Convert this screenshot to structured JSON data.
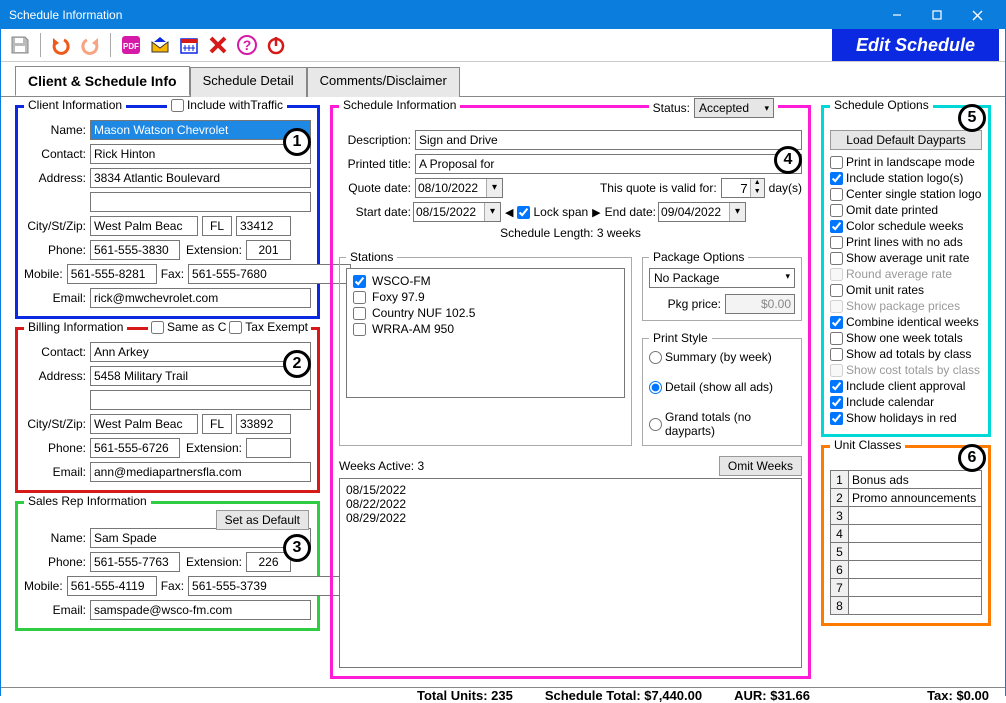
{
  "window": {
    "title": "Schedule Information"
  },
  "edit_btn": "Edit Schedule",
  "tabs": [
    "Client & Schedule Info",
    "Schedule Detail",
    "Comments/Disclaimer"
  ],
  "client": {
    "title": "Client Information",
    "include_traffic": "Include withTraffic",
    "name_lbl": "Name:",
    "name": "Mason Watson Chevrolet",
    "contact_lbl": "Contact:",
    "contact": "Rick Hinton",
    "address_lbl": "Address:",
    "address": "3834 Atlantic Boulevard",
    "csz_lbl": "City/St/Zip:",
    "city": "West Palm Beac",
    "state": "FL",
    "zip": "33412",
    "phone_lbl": "Phone:",
    "phone": "561-555-3830",
    "ext_lbl": "Extension:",
    "ext": "201",
    "mobile_lbl": "Mobile:",
    "mobile": "561-555-8281",
    "fax_lbl": "Fax:",
    "fax": "561-555-7680",
    "email_lbl": "Email:",
    "email": "rick@mwchevrolet.com"
  },
  "billing": {
    "title": "Billing Information",
    "same_lbl": "Same as Client",
    "taxexempt_lbl": "Tax Exempt",
    "contact_lbl": "Contact:",
    "contact": "Ann Arkey",
    "address_lbl": "Address:",
    "address": "5458 Military Trail",
    "csz_lbl": "City/St/Zip:",
    "city": "West Palm Beac",
    "state": "FL",
    "zip": "33892",
    "phone_lbl": "Phone:",
    "phone": "561-555-6726",
    "ext_lbl": "Extension:",
    "ext": "",
    "email_lbl": "Email:",
    "email": "ann@mediapartnersfla.com"
  },
  "salesrep": {
    "title": "Sales Rep Information",
    "setdefault": "Set as Default",
    "name_lbl": "Name:",
    "name": "Sam Spade",
    "phone_lbl": "Phone:",
    "phone": "561-555-7763",
    "ext_lbl": "Extension:",
    "ext": "226",
    "mobile_lbl": "Mobile:",
    "mobile": "561-555-4119",
    "fax_lbl": "Fax:",
    "fax": "561-555-3739",
    "email_lbl": "Email:",
    "email": "samspade@wsco-fm.com"
  },
  "sched": {
    "title": "Schedule Information",
    "status_lbl": "Status:",
    "status": "Accepted",
    "desc_lbl": "Description:",
    "desc": "Sign and Drive",
    "ptitle_lbl": "Printed title:",
    "ptitle": "A Proposal for",
    "qdate_lbl": "Quote date:",
    "qdate": "08/10/2022",
    "valid_lbl": "This quote is valid for:",
    "valid_days": "7",
    "days_lbl": "day(s)",
    "sdate_lbl": "Start date:",
    "sdate": "08/15/2022",
    "lockspan": "Lock span",
    "endtri": "▶",
    "edate_lbl": "End date:",
    "edate": "09/04/2022",
    "schedlen": "Schedule Length: 3 weeks",
    "stations_lbl": "Stations",
    "stations": [
      "WSCO-FM",
      "Foxy 97.9",
      "Country NUF 102.5",
      "WRRA-AM 950"
    ],
    "pkg_lbl": "Package Options",
    "pkg": "No Package",
    "pkgprice_lbl": "Pkg price:",
    "pkgprice": "$0.00",
    "pstyle_lbl": "Print Style",
    "pstyle": [
      "Summary (by week)",
      "Detail (show all ads)",
      "Grand totals (no dayparts)"
    ],
    "weeks_lbl": "Weeks Active: 3",
    "omit": "Omit Weeks",
    "weeks": [
      "08/15/2022",
      "08/22/2022",
      "08/29/2022"
    ]
  },
  "opts": {
    "title": "Schedule Options",
    "loadbtn": "Load Default Dayparts",
    "items": [
      {
        "c": false,
        "t": "Print in landscape mode"
      },
      {
        "c": true,
        "t": "Include station logo(s)"
      },
      {
        "c": false,
        "t": "Center single station logo"
      },
      {
        "c": false,
        "t": "Omit date printed"
      },
      {
        "c": true,
        "t": "Color schedule weeks"
      },
      {
        "c": false,
        "t": "Print lines with no ads"
      },
      {
        "c": false,
        "t": "Show average unit rate"
      },
      {
        "c": false,
        "t": "Round average rate",
        "d": true
      },
      {
        "c": false,
        "t": "Omit unit rates"
      },
      {
        "c": false,
        "t": "Show package prices",
        "d": true
      },
      {
        "c": true,
        "t": "Combine identical weeks"
      },
      {
        "c": false,
        "t": "Show one week totals"
      },
      {
        "c": false,
        "t": "Show ad totals by class"
      },
      {
        "c": false,
        "t": "Show cost totals by class",
        "d": true
      },
      {
        "c": true,
        "t": "Include client approval"
      },
      {
        "c": true,
        "t": "Include calendar"
      },
      {
        "c": true,
        "t": "Show holidays in red"
      }
    ]
  },
  "units": {
    "title": "Unit Classes",
    "rows": [
      "Bonus ads",
      "Promo announcements",
      "",
      "",
      "",
      "",
      "",
      ""
    ]
  },
  "status": {
    "units": "Total Units: 235",
    "total": "Schedule Total: $7,440.00",
    "aur": "AUR: $31.66",
    "tax": "Tax: $0.00"
  }
}
